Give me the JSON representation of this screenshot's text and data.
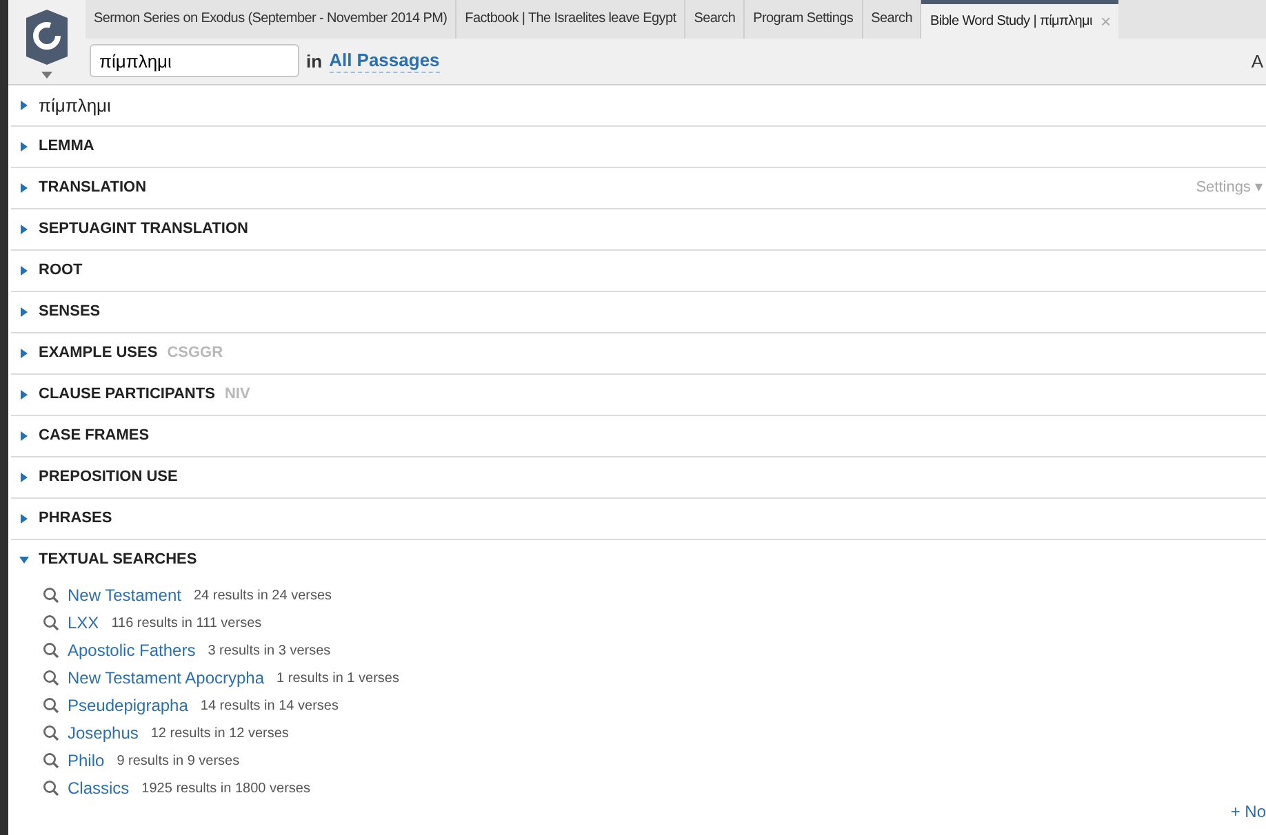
{
  "tabs": [
    {
      "label": "Sermon Series on Exodus (September - November 2014 PM)",
      "selected": false
    },
    {
      "label": "Factbook | The Israelites leave Egypt",
      "selected": false
    },
    {
      "label": "Search",
      "selected": false
    },
    {
      "label": "Program Settings",
      "selected": false
    },
    {
      "label": "Search",
      "selected": false
    },
    {
      "label": "Bible Word Study | πίμπλημι",
      "selected": true,
      "close": "×"
    }
  ],
  "toolbar": {
    "search_value": "πίμπλημι",
    "in_label": "in",
    "range": "All Passages",
    "right_edge": "A"
  },
  "sections": [
    {
      "title": "πίμπλημι",
      "kind": "word",
      "expanded": false
    },
    {
      "title": "LEMMA",
      "kind": "heading",
      "expanded": false
    },
    {
      "title": "TRANSLATION",
      "kind": "heading",
      "expanded": false,
      "settings": "Settings ▾"
    },
    {
      "title": "SEPTUAGINT TRANSLATION",
      "kind": "heading",
      "expanded": false
    },
    {
      "title": "ROOT",
      "kind": "heading",
      "expanded": false
    },
    {
      "title": "SENSES",
      "kind": "heading",
      "expanded": false
    },
    {
      "title": "EXAMPLE USES",
      "kind": "heading",
      "expanded": false,
      "tag": "CSGGR"
    },
    {
      "title": "CLAUSE PARTICIPANTS",
      "kind": "heading",
      "expanded": false,
      "tag": "NIV"
    },
    {
      "title": "CASE FRAMES",
      "kind": "heading",
      "expanded": false
    },
    {
      "title": "PREPOSITION USE",
      "kind": "heading",
      "expanded": false
    },
    {
      "title": "PHRASES",
      "kind": "heading",
      "expanded": false
    },
    {
      "title": "TEXTUAL SEARCHES",
      "kind": "heading",
      "expanded": true,
      "items": [
        {
          "name": "New Testament",
          "count": "24 results in 24 verses"
        },
        {
          "name": "LXX",
          "count": "116 results in 111 verses"
        },
        {
          "name": "Apostolic Fathers",
          "count": "3 results in 3 verses"
        },
        {
          "name": "New Testament Apocrypha",
          "count": "1 results in 1 verses"
        },
        {
          "name": "Pseudepigrapha",
          "count": "14 results in 14 verses"
        },
        {
          "name": "Josephus",
          "count": "12 results in 12 verses"
        },
        {
          "name": "Philo",
          "count": "9 results in 9 verses"
        },
        {
          "name": "Classics",
          "count": "1925 results in 1800 verses"
        }
      ]
    }
  ],
  "footer_link": "+ No"
}
